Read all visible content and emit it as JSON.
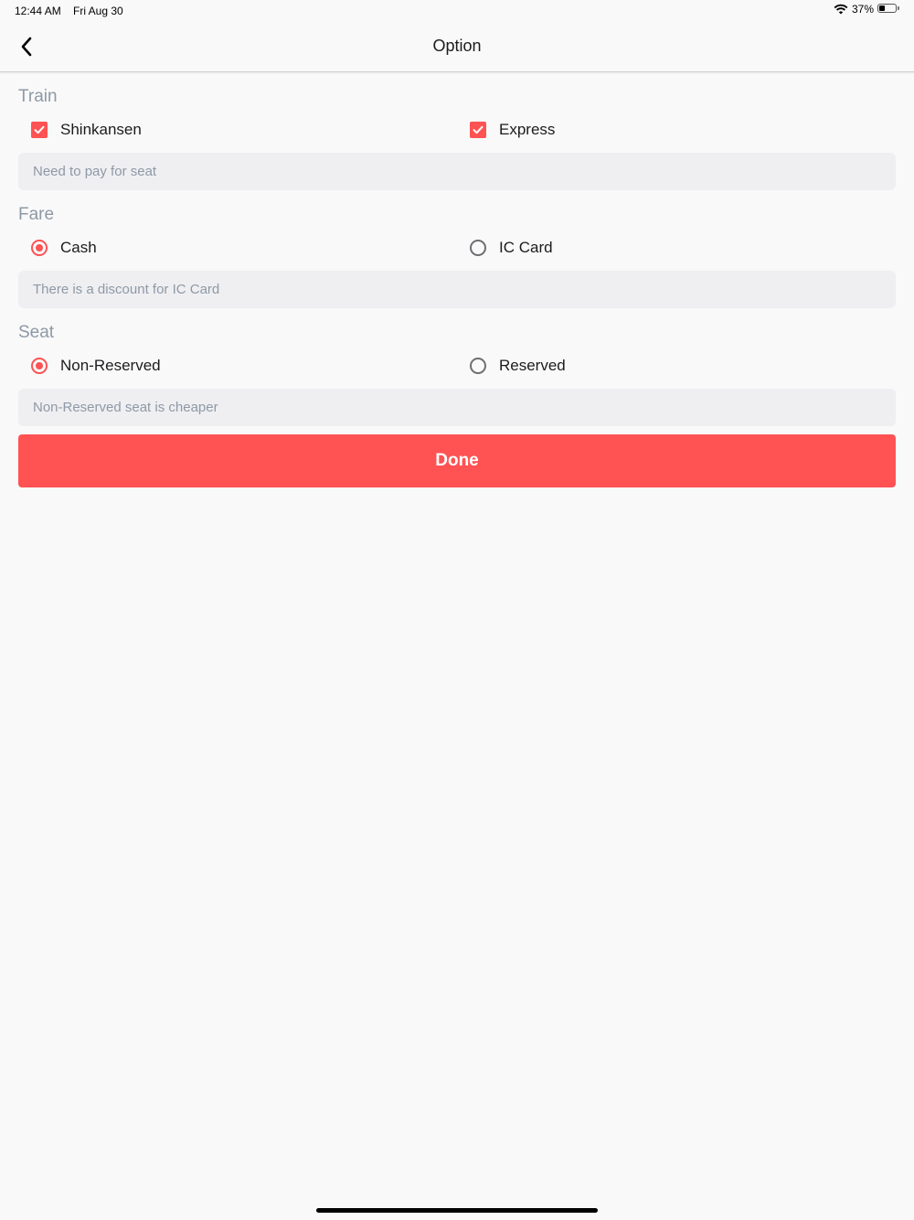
{
  "status_bar": {
    "time": "12:44 AM",
    "date": "Fri Aug 30",
    "battery_percent": "37%",
    "battery_level": 0.37
  },
  "nav": {
    "back_icon": "chevron-left-icon",
    "title": "Option"
  },
  "sections": {
    "train": {
      "title": "Train",
      "options": [
        {
          "label": "Shinkansen",
          "type": "checkbox",
          "checked": true
        },
        {
          "label": "Express",
          "type": "checkbox",
          "checked": true
        }
      ],
      "note": "Need to pay for seat"
    },
    "fare": {
      "title": "Fare",
      "options": [
        {
          "label": "Cash",
          "type": "radio",
          "checked": true
        },
        {
          "label": "IC Card",
          "type": "radio",
          "checked": false
        }
      ],
      "note": "There is a discount for IC Card"
    },
    "seat": {
      "title": "Seat",
      "options": [
        {
          "label": "Non-Reserved",
          "type": "radio",
          "checked": true
        },
        {
          "label": "Reserved",
          "type": "radio",
          "checked": false
        }
      ],
      "note": "Non-Reserved seat is cheaper"
    }
  },
  "done_label": "Done",
  "colors": {
    "accent": "#fe5253",
    "section_title": "#8e99a6",
    "note_background": "#efeff2"
  }
}
